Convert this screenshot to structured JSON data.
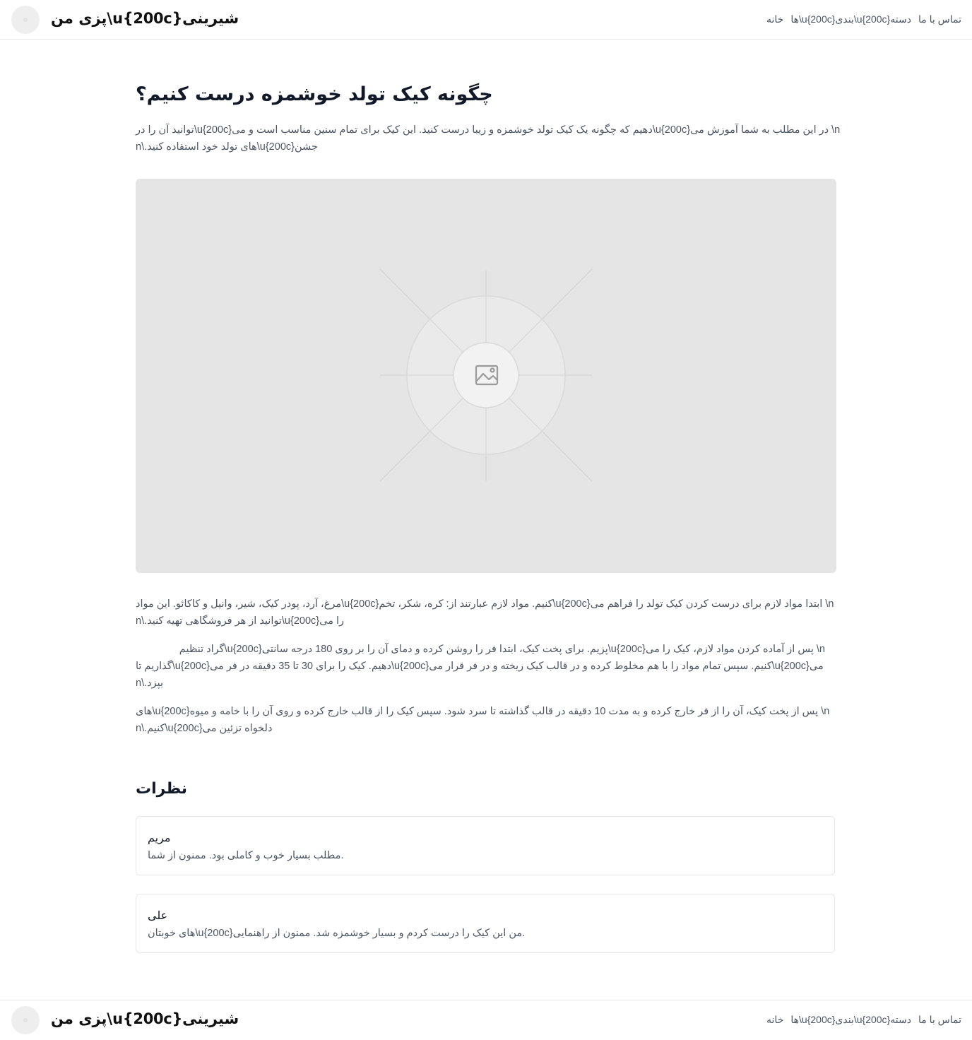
{
  "header": {
    "brand": "پزی من\\u{200c}شیرینی",
    "links": [
      "تماس با ما",
      "ها\\u{200c}بندی\\u{200c}دسته",
      "خانه"
    ]
  },
  "article": {
    "title": "چگونه کیک تولد خوشمزه درست کنیم؟",
    "intro": [
      "توانید آن را در\\u{200c}دهیم که چگونه یک کیک تولد خوشمزه و زیبا درست کنید. این کیک برای تمام سنین مناسب است و می\\u{200c}در این مطلب به شما آموزش می \\n",
      "n\\.های تولد خود استفاده کنید\\u{200c}جشن"
    ],
    "hero_icon": "image-placeholder-icon",
    "paragraphs": [
      [
        "مرغ، آرد، پودر کیک، شیر، وانیل و کاکائو. این مواد\\u{200c}کنیم. مواد لازم عبارتند از: کره، شکر، تخم\\u{200c}ابتدا مواد لازم برای درست کردن کیک تولد را فراهم می \\n",
        "n\\.توانید از هر فروشگاهی تهیه کنید\\u{200c}را می"
      ],
      [
        "گراد تنظیم\\u{200c}پزیم. برای پخت کیک، ابتدا فر را روشن کرده و دمای آن را بر روی 180 درجه سانتی\\u{200c}پس از آماده کردن مواد لازم، کیک را می \\n",
        "گذاریم تا\\u{200c}دهیم. کیک را برای 30 تا 35 دقیقه در فر می\\u{200c}کنیم. سپس تمام مواد را با هم مخلوط کرده و در قالب کیک ریخته و در فر قرار می\\u{200c}می",
        "n\\.بپزد"
      ],
      [
        "های\\u{200c}پس از پخت کیک، آن را از فر خارج کرده و به مدت 10 دقیقه در قالب گذاشته تا سرد شود. سپس کیک را از قالب خارج کرده و روی آن را با خامه و میوه \\n",
        "n\\.کنیم\\u{200c}دلخواه تزئین می"
      ]
    ]
  },
  "comments": {
    "title": "نظرات",
    "items": [
      {
        "name": "مریم",
        "text": "مطلب بسیار خوب و کاملی بود. ممنون از شما."
      },
      {
        "name": "علی",
        "text": "های خوبتان\\u{200c}من این کیک را درست کردم و بسیار خوشمزه شد. ممنون از راهنمایی."
      }
    ]
  },
  "footer": {
    "brand": "پزی من\\u{200c}شیرینی",
    "links": [
      "تماس با ما",
      "ها\\u{200c}بندی\\u{200c}دسته",
      "خانه"
    ]
  },
  "colors": {
    "placeholder_bg": "#e5e5e5",
    "border": "#e5e7eb",
    "muted_text": "#4b5563"
  }
}
